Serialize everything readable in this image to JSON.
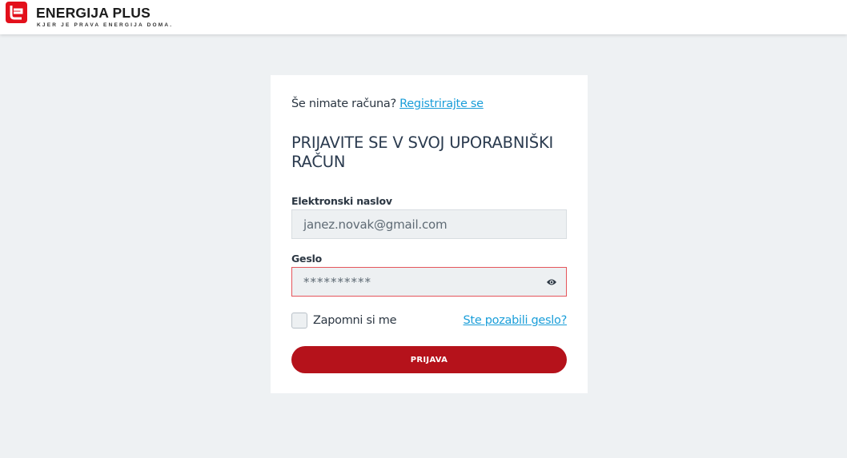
{
  "header": {
    "brand_name": "ENERGIJA PLUS",
    "tagline": "KJER JE PRAVA ENERGIJA DOMA.",
    "brand_color": "#e3101b"
  },
  "login": {
    "signup_prompt": "Še nimate računa?",
    "signup_link": "Registrirajte se",
    "title": "PRIJAVITE SE V SVOJ UPORABNIŠKI RAČUN",
    "email_label": "Elektronski naslov",
    "email_value": "janez.novak@gmail.com",
    "password_label": "Geslo",
    "password_value": "**********",
    "remember_label": "Zapomni si me",
    "forgot_link": "Ste pozabili geslo?",
    "submit_label": "PRIJAVA",
    "colors": {
      "button": "#b5121b",
      "link": "#1a9ed9",
      "error_border": "#e5555b"
    }
  }
}
